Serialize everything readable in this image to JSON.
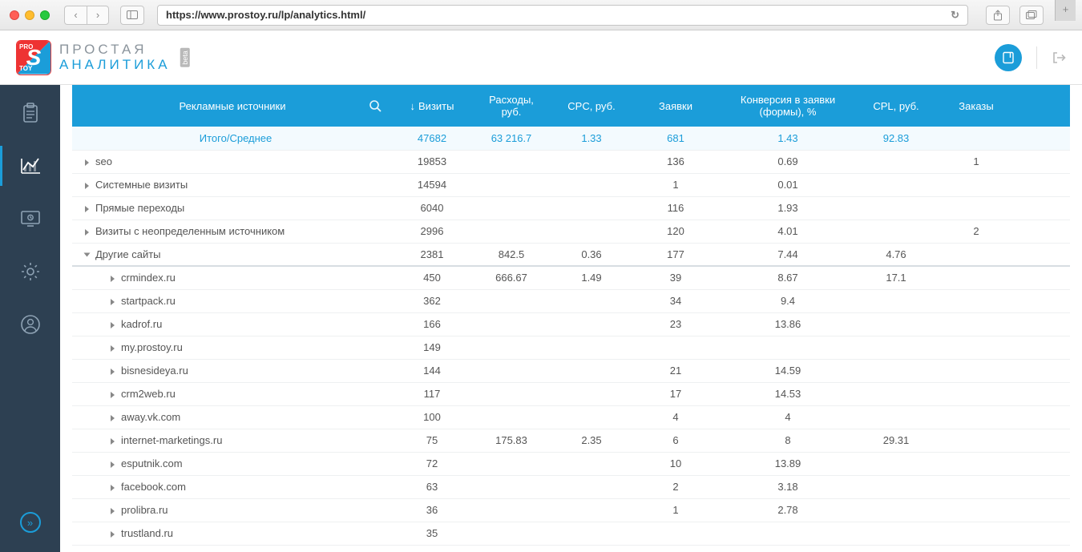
{
  "browser": {
    "url": "https://www.prostoy.ru/lp/analytics.html/"
  },
  "brand": {
    "line1": "ПРОСТАЯ",
    "line2": "АНАЛИТИКА",
    "beta": "beta"
  },
  "columns": {
    "sources": "Рекламные источники",
    "visits": "Визиты",
    "expenses": "Расходы, руб.",
    "cpc": "CPC, руб.",
    "requests": "Заявки",
    "conversion": "Конверсия в заявки (формы), %",
    "cpl": "CPL, руб.",
    "orders": "Заказы"
  },
  "totals": {
    "label": "Итого/Среднее",
    "visits": "47682",
    "expenses": "63 216.7",
    "cpc": "1.33",
    "requests": "681",
    "conversion": "1.43",
    "cpl": "92.83",
    "orders": ""
  },
  "rows": [
    {
      "name": "seo",
      "visits": "19853",
      "expenses": "",
      "cpc": "",
      "requests": "136",
      "conversion": "0.69",
      "cpl": "",
      "orders": "1",
      "expand": "closed"
    },
    {
      "name": "Системные визиты",
      "visits": "14594",
      "expenses": "",
      "cpc": "",
      "requests": "1",
      "conversion": "0.01",
      "cpl": "",
      "orders": "",
      "expand": "closed"
    },
    {
      "name": "Прямые переходы",
      "visits": "6040",
      "expenses": "",
      "cpc": "",
      "requests": "116",
      "conversion": "1.93",
      "cpl": "",
      "orders": "",
      "expand": "closed"
    },
    {
      "name": "Визиты с неопределенным источником",
      "visits": "2996",
      "expenses": "",
      "cpc": "",
      "requests": "120",
      "conversion": "4.01",
      "cpl": "",
      "orders": "2",
      "expand": "closed"
    },
    {
      "name": "Другие сайты",
      "visits": "2381",
      "expenses": "842.5",
      "cpc": "0.36",
      "requests": "177",
      "conversion": "7.44",
      "cpl": "4.76",
      "orders": "",
      "expand": "open"
    }
  ],
  "children": [
    {
      "name": "crmindex.ru",
      "visits": "450",
      "expenses": "666.67",
      "cpc": "1.49",
      "requests": "39",
      "conversion": "8.67",
      "cpl": "17.1",
      "orders": ""
    },
    {
      "name": "startpack.ru",
      "visits": "362",
      "expenses": "",
      "cpc": "",
      "requests": "34",
      "conversion": "9.4",
      "cpl": "",
      "orders": ""
    },
    {
      "name": "kadrof.ru",
      "visits": "166",
      "expenses": "",
      "cpc": "",
      "requests": "23",
      "conversion": "13.86",
      "cpl": "",
      "orders": ""
    },
    {
      "name": "my.prostoy.ru",
      "visits": "149",
      "expenses": "",
      "cpc": "",
      "requests": "",
      "conversion": "",
      "cpl": "",
      "orders": ""
    },
    {
      "name": "bisnesideya.ru",
      "visits": "144",
      "expenses": "",
      "cpc": "",
      "requests": "21",
      "conversion": "14.59",
      "cpl": "",
      "orders": ""
    },
    {
      "name": "crm2web.ru",
      "visits": "117",
      "expenses": "",
      "cpc": "",
      "requests": "17",
      "conversion": "14.53",
      "cpl": "",
      "orders": ""
    },
    {
      "name": "away.vk.com",
      "visits": "100",
      "expenses": "",
      "cpc": "",
      "requests": "4",
      "conversion": "4",
      "cpl": "",
      "orders": ""
    },
    {
      "name": "internet-marketings.ru",
      "visits": "75",
      "expenses": "175.83",
      "cpc": "2.35",
      "requests": "6",
      "conversion": "8",
      "cpl": "29.31",
      "orders": ""
    },
    {
      "name": "esputnik.com",
      "visits": "72",
      "expenses": "",
      "cpc": "",
      "requests": "10",
      "conversion": "13.89",
      "cpl": "",
      "orders": ""
    },
    {
      "name": "facebook.com",
      "visits": "63",
      "expenses": "",
      "cpc": "",
      "requests": "2",
      "conversion": "3.18",
      "cpl": "",
      "orders": ""
    },
    {
      "name": "prolibra.ru",
      "visits": "36",
      "expenses": "",
      "cpc": "",
      "requests": "1",
      "conversion": "2.78",
      "cpl": "",
      "orders": ""
    },
    {
      "name": "trustland.ru",
      "visits": "35",
      "expenses": "",
      "cpc": "",
      "requests": "",
      "conversion": "",
      "cpl": "",
      "orders": ""
    }
  ]
}
